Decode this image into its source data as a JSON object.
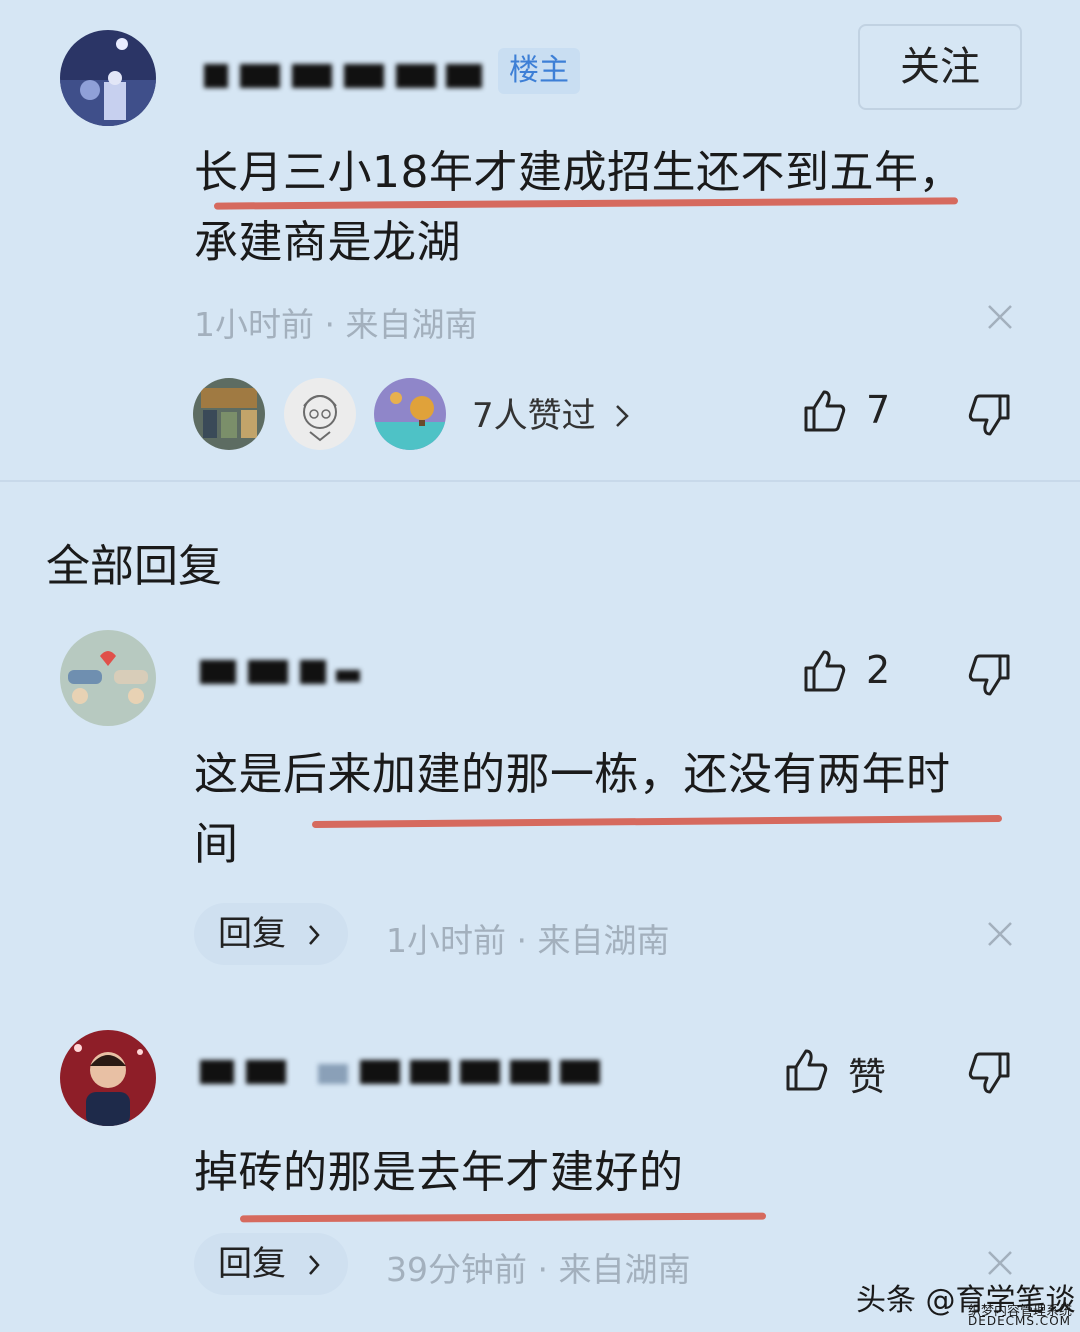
{
  "main_comment": {
    "author_badge": "楼主",
    "follow_label": "关注",
    "text_line1": "长月三小18年才建成招生还不到五年，",
    "text_line2": "承建商是龙湖",
    "meta": "1小时前 · 来自湖南",
    "likers_text": "7人赞过",
    "like_count": "7"
  },
  "replies_section_title": "全部回复",
  "replies": [
    {
      "like_count": "2",
      "text_line1": "这是后来加建的那一栋，还没有两年时",
      "text_line2": "间",
      "reply_label": "回复",
      "meta": "1小时前 · 来自湖南"
    },
    {
      "like_label": "赞",
      "text_line1": "掉砖的那是去年才建好的",
      "reply_label": "回复",
      "meta": "39分钟前 · 来自湖南"
    }
  ],
  "watermark": {
    "main": "头条 @育学笔谈",
    "sub": "织梦内容管理系统",
    "site": "DEDECMS.COM"
  },
  "colors": {
    "background": "#d6e6f4",
    "underline": "#d66a5e",
    "meta_text": "#a3b0bd",
    "badge_text": "#3d7fd6"
  }
}
